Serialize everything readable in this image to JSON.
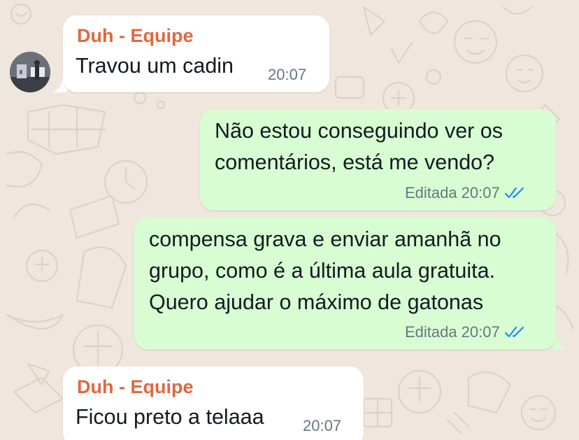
{
  "conversation": {
    "messages": [
      {
        "direction": "incoming",
        "sender": "Duh - Equipe",
        "text": "Travou um cadin",
        "time": "20:07"
      },
      {
        "direction": "outgoing",
        "lines": [
          "Não estou conseguindo ver os",
          "comentários, está me vendo?"
        ],
        "edited_label": "Editada",
        "time": "20:07",
        "status": "read"
      },
      {
        "direction": "outgoing",
        "lines": [
          "compensa grava e enviar amanhã no",
          "grupo, como é a última aula gratuita.",
          "Quero ajudar o máximo de gatonas"
        ],
        "edited_label": "Editada",
        "time": "20:07",
        "status": "read"
      },
      {
        "direction": "incoming",
        "sender": "Duh - Equipe",
        "text": "Ficou preto a telaaa",
        "time": "20:07"
      }
    ]
  },
  "colors": {
    "background": "#efe7de",
    "incoming_bubble": "#ffffff",
    "outgoing_bubble": "#d9fdd3",
    "sender_name": "#e2673f",
    "meta_text": "#667781",
    "read_checks": "#1b8cf5"
  },
  "icons": {
    "avatar": "contact-avatar-photo",
    "status": "double-check-read-icon"
  }
}
